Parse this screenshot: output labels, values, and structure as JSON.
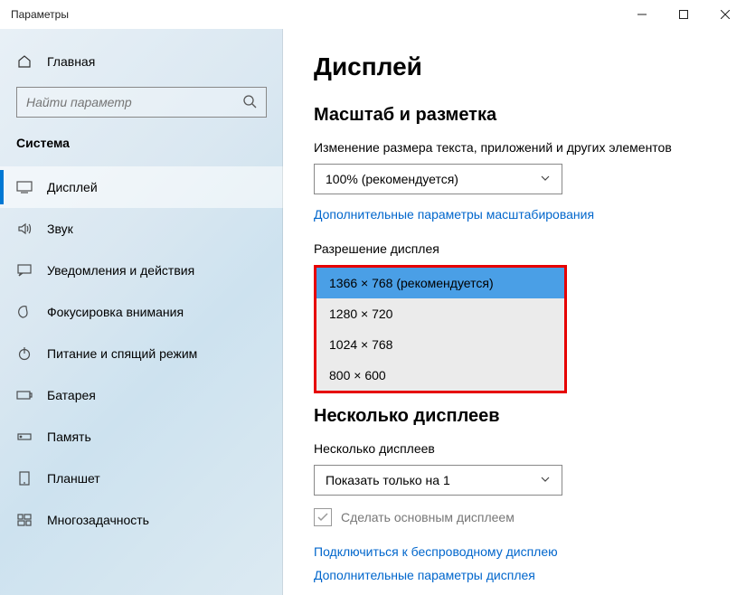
{
  "window": {
    "title": "Параметры"
  },
  "sidebar": {
    "home": "Главная",
    "search_placeholder": "Найти параметр",
    "heading": "Система",
    "items": [
      {
        "label": "Дисплей"
      },
      {
        "label": "Звук"
      },
      {
        "label": "Уведомления и действия"
      },
      {
        "label": "Фокусировка внимания"
      },
      {
        "label": "Питание и спящий режим"
      },
      {
        "label": "Батарея"
      },
      {
        "label": "Память"
      },
      {
        "label": "Планшет"
      },
      {
        "label": "Многозадачность"
      }
    ]
  },
  "main": {
    "title": "Дисплей",
    "scale_heading": "Масштаб и разметка",
    "scale_label": "Изменение размера текста, приложений и других элементов",
    "scale_value": "100% (рекомендуется)",
    "advanced_scaling_link": "Дополнительные параметры масштабирования",
    "resolution_label": "Разрешение дисплея",
    "resolution_options": [
      "1366 × 768 (рекомендуется)",
      "1280 × 720",
      "1024 × 768",
      "800 × 600"
    ],
    "multi_heading": "Несколько дисплеев",
    "multi_label": "Несколько дисплеев",
    "multi_value": "Показать только на 1",
    "make_main_label": "Сделать основным дисплеем",
    "connect_wireless_link": "Подключиться к беспроводному дисплею",
    "advanced_display_link": "Дополнительные параметры дисплея"
  }
}
